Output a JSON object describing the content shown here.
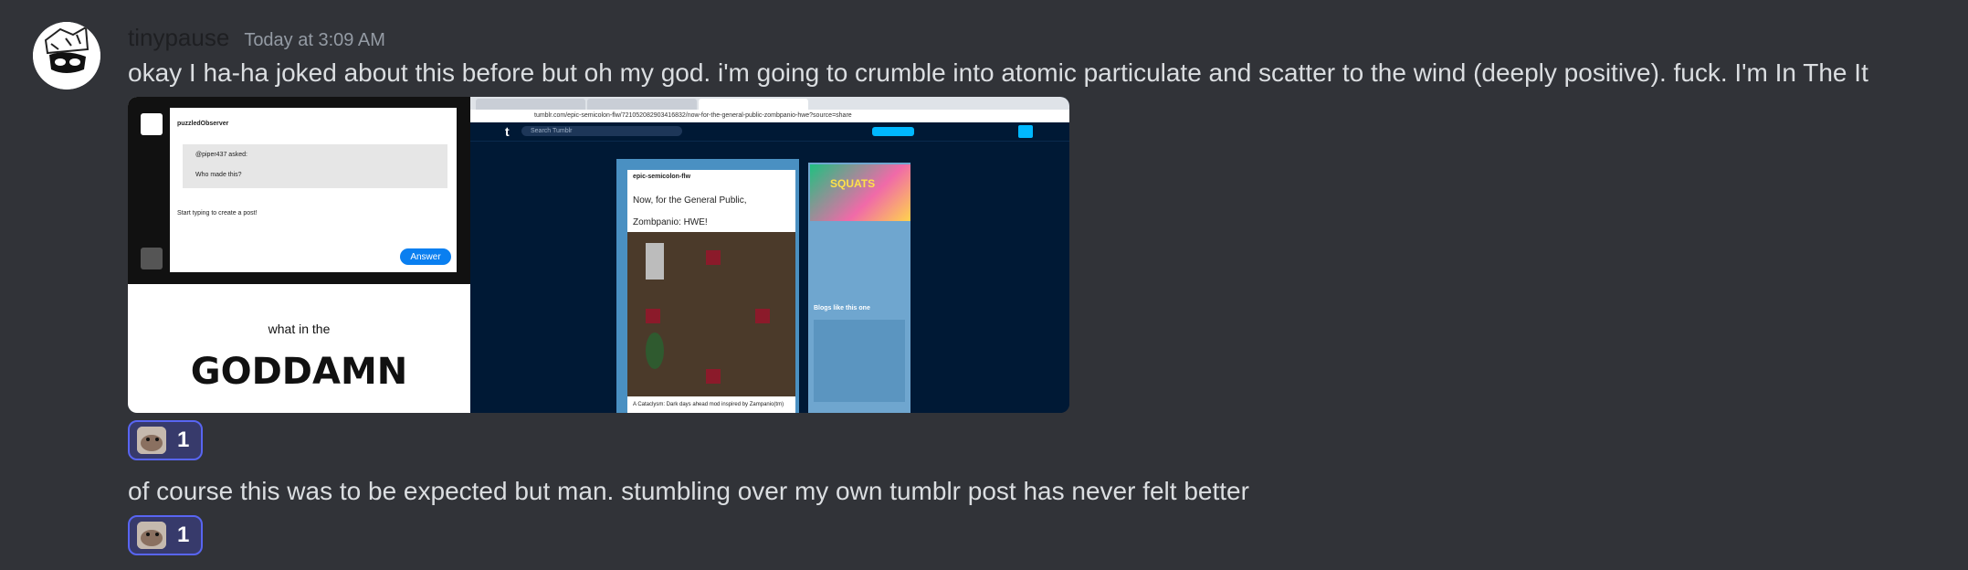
{
  "message": {
    "username": "tinypause",
    "timestamp": "Today at 3:09 AM",
    "text": "okay I ha-ha joked about this before but oh my god. i'm going to crumble into atomic particulate and scatter to the wind (deeply positive). fuck. I'm In The It",
    "attachment": {
      "meme_top": "what in the",
      "meme_bottom": "GODDAMN",
      "ask_user": "puzzledObserver",
      "ask_handle": "@piper437 asked:",
      "ask_question": "Who made this?",
      "ask_prompt": "Start typing to create a post!",
      "answer_button": "Answer",
      "browser_url": "tumblr.com/epic-semicolon-flw/721052082903416832/now-for-the-general-public-zombpanio-hwe?source=share",
      "search_placeholder": "Search Tumblr",
      "post_author": "epic-semicolon-flw",
      "post_line1": "Now, for the General Public,",
      "post_line2": "Zombpanio: HWE!",
      "post_caption": "A Cataclysm: Dark days ahead mod inspired by Zampanio(tm)",
      "banner_text": "SQUATS",
      "sidebar_heading": "Blogs like this one"
    },
    "reaction": {
      "count": "1"
    }
  },
  "followup": {
    "text": "of course this was to be expected but man. stumbling over my own tumblr post has never felt better",
    "reaction": {
      "count": "1"
    }
  }
}
